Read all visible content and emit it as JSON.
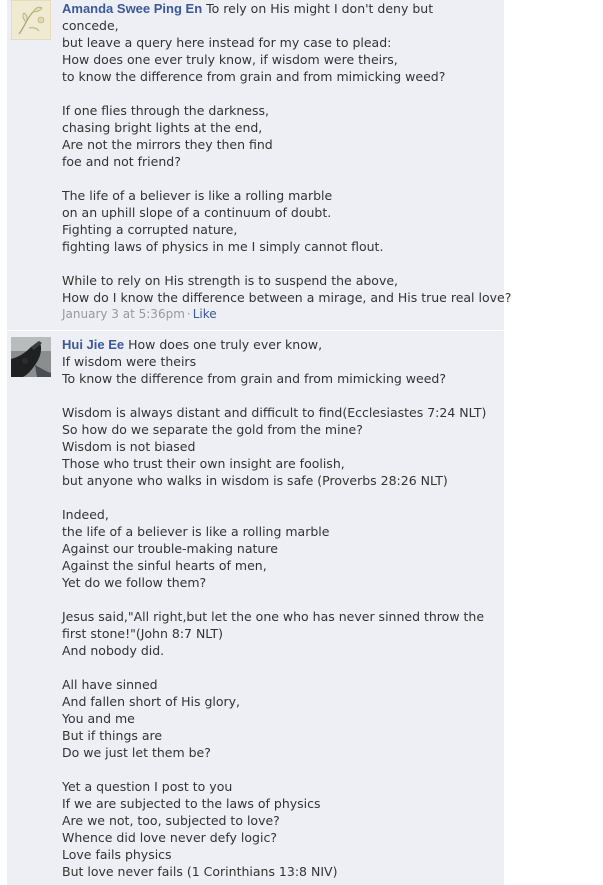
{
  "comments": [
    {
      "author": "Amanda Swee Ping En",
      "avatar": "flower-sketch-avatar",
      "lines": [
        "To rely on His might I don't deny but",
        "concede,",
        "but leave a query here instead for my case to plead:",
        "How does one ever truly know, if wisdom were theirs,",
        "to know the difference from grain and from mimicking weed?",
        "",
        "If one flies through the darkness,",
        "chasing bright lights at the end,",
        "Are not the mirrors they then find",
        "foe and not friend?",
        "",
        "The life of a believer is like a rolling marble",
        "on an uphill slope of a continuum of doubt.",
        "Fighting a corrupted nature,",
        "fighting laws of physics in me I simply cannot flout.",
        "",
        "While to rely on His strength is to suspend the above,",
        "How do I know the difference between a mirage, and His true real love?"
      ],
      "timestamp": "January 3 at 5:36pm",
      "separator": "·",
      "like_label": "Like"
    },
    {
      "author": "Hui Jie Ee",
      "avatar": "dark-photo-avatar",
      "lines": [
        "How does one truly ever know,",
        "If wisdom were theirs",
        "To know the difference from grain and from mimicking weed?",
        "",
        "Wisdom is always distant and difficult to find(Ecclesiastes 7:24 NLT)",
        "So how do we separate the gold from the mine?",
        "Wisdom is not biased",
        "Those who trust their own insight are foolish,",
        "but anyone who walks in wisdom is safe (Proverbs 28:26 NLT)",
        "",
        "Indeed,",
        "the life of a believer is like a rolling marble",
        "Against our trouble-making nature",
        "Against the sinful hearts of men,",
        "Yet do we follow them?",
        "",
        "Jesus said,\"All right,but let the one who has never sinned throw the",
        "first stone!\"(John 8:7 NLT)",
        "And nobody did.",
        "",
        "All have sinned",
        "And fallen short of His glory,",
        "You and me",
        "But if things are",
        "Do we just let them be?",
        "",
        "Yet a question I post to you",
        "If we are subjected to the laws of physics",
        "Are we not, too, subjected to love?",
        "Whence did love never defy logic?",
        "Love fails physics",
        "But love never fails (1 Corinthians 13:8 NIV)"
      ]
    }
  ],
  "colors": {
    "comment_bg": "#edeff4",
    "author_link": "#3b5998",
    "timestamp": "#999999"
  }
}
